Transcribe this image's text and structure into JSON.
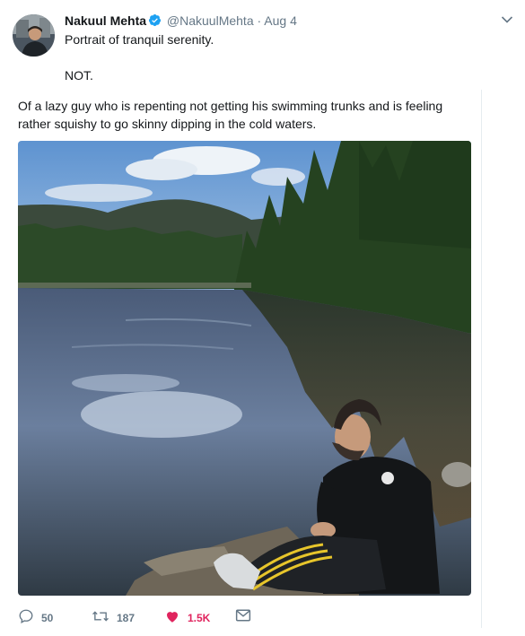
{
  "tweet": {
    "author_name": "Nakuul Mehta",
    "handle": "@NakuulMehta",
    "separator": "·",
    "date": "Aug 4",
    "line1": "Portrait of tranquil serenity.",
    "line2": "NOT.",
    "body": "Of a lazy guy who is repenting not getting his swimming trunks and is feeling rather squishy to go skinny dipping in the cold waters."
  },
  "actions": {
    "replies": "50",
    "retweets": "187",
    "likes": "1.5K"
  },
  "icons": {
    "verified": "verified-badge-icon",
    "menu": "chevron-down-icon",
    "reply": "reply-icon",
    "retweet": "retweet-icon",
    "like": "heart-icon",
    "dm": "envelope-icon"
  },
  "colors": {
    "verified": "#1da1f2",
    "like": "#e0245e",
    "muted": "#657786"
  }
}
